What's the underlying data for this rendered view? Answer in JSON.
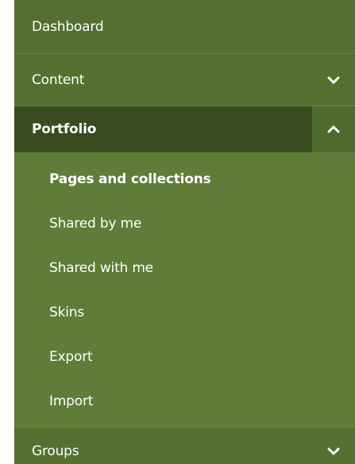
{
  "nav": {
    "items": [
      {
        "label": "Dashboard",
        "toggle_icon": ""
      },
      {
        "label": "Content",
        "toggle_icon": "chevron-down-icon"
      },
      {
        "label": "Portfolio",
        "toggle_icon": "chevron-up-icon"
      },
      {
        "label": "Groups",
        "toggle_icon": "chevron-down-icon"
      }
    ],
    "portfolio_sub_items": [
      {
        "label": "Pages and collections",
        "current": true
      },
      {
        "label": "Shared by me"
      },
      {
        "label": "Shared with me"
      },
      {
        "label": "Skins"
      },
      {
        "label": "Export"
      },
      {
        "label": "Import"
      }
    ]
  },
  "colors": {
    "menu_background": "#5f7c38",
    "top_item_background": "#546f30",
    "active_item_background": "#3a4b22",
    "active_toggle_background": "#4f6a2d",
    "text": "#ffffff"
  }
}
